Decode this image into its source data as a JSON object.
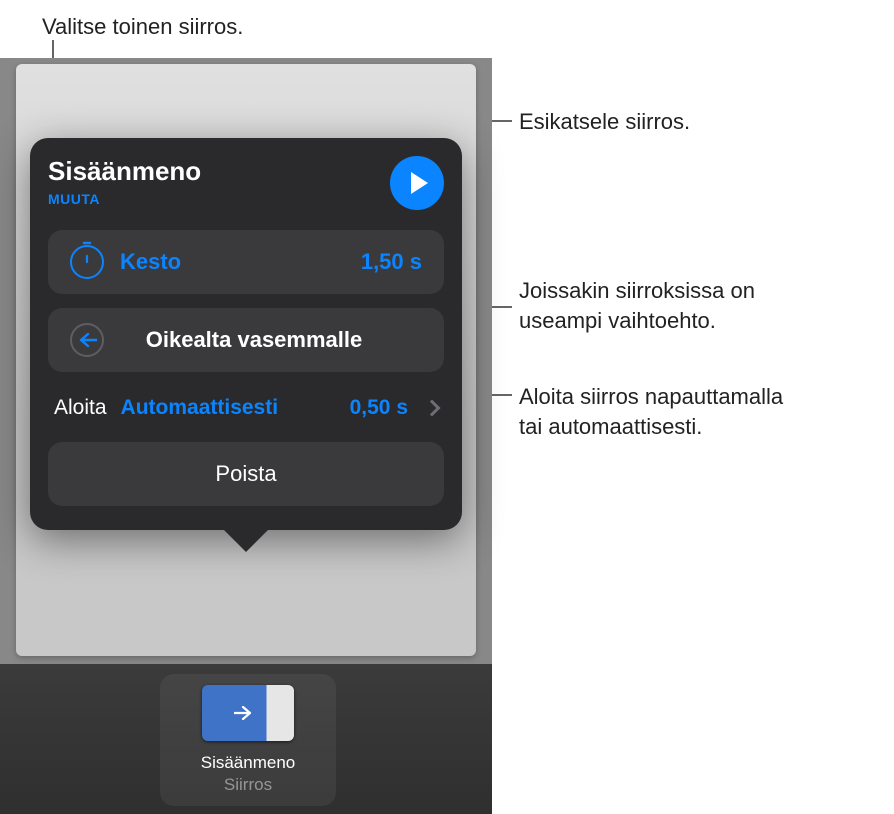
{
  "callouts": {
    "change": "Valitse toinen siirros.",
    "preview": "Esikatsele siirros.",
    "options": "Joissakin siirroksissa on\nuseampi vaihtoehto.",
    "start": "Aloita siirros napauttamalla\ntai automaattisesti."
  },
  "popover": {
    "title": "Sisäänmeno",
    "change_label": "MUUTA",
    "duration": {
      "label": "Kesto",
      "value": "1,50 s"
    },
    "direction": {
      "label": "Oikealta vasemmalle",
      "icon": "arrow-left-icon"
    },
    "start": {
      "label": "Aloita",
      "type": "Automaattisesti",
      "delay": "0,50 s"
    },
    "delete_label": "Poista"
  },
  "bottom_chip": {
    "title": "Sisäänmeno",
    "subtitle": "Siirros"
  }
}
